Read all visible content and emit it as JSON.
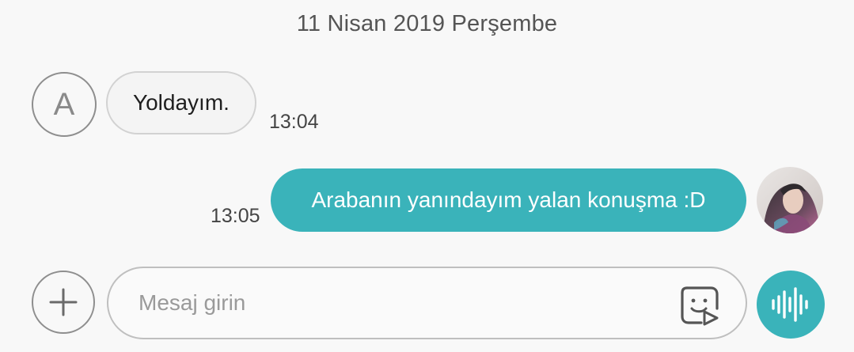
{
  "date_header": "11 Nisan 2019 Perşembe",
  "incoming": {
    "avatar_letter": "A",
    "text": "Yoldayım.",
    "time": "13:04"
  },
  "outgoing": {
    "text": "Arabanın yanındayım yalan konuşma :D",
    "time": "13:05"
  },
  "composer": {
    "placeholder": "Mesaj girin"
  },
  "icons": {
    "add": "plus-icon",
    "sticker": "sticker-icon",
    "voice": "voice-wave-icon"
  },
  "colors": {
    "accent": "#3ab3ba",
    "background": "#f8f8f8"
  }
}
